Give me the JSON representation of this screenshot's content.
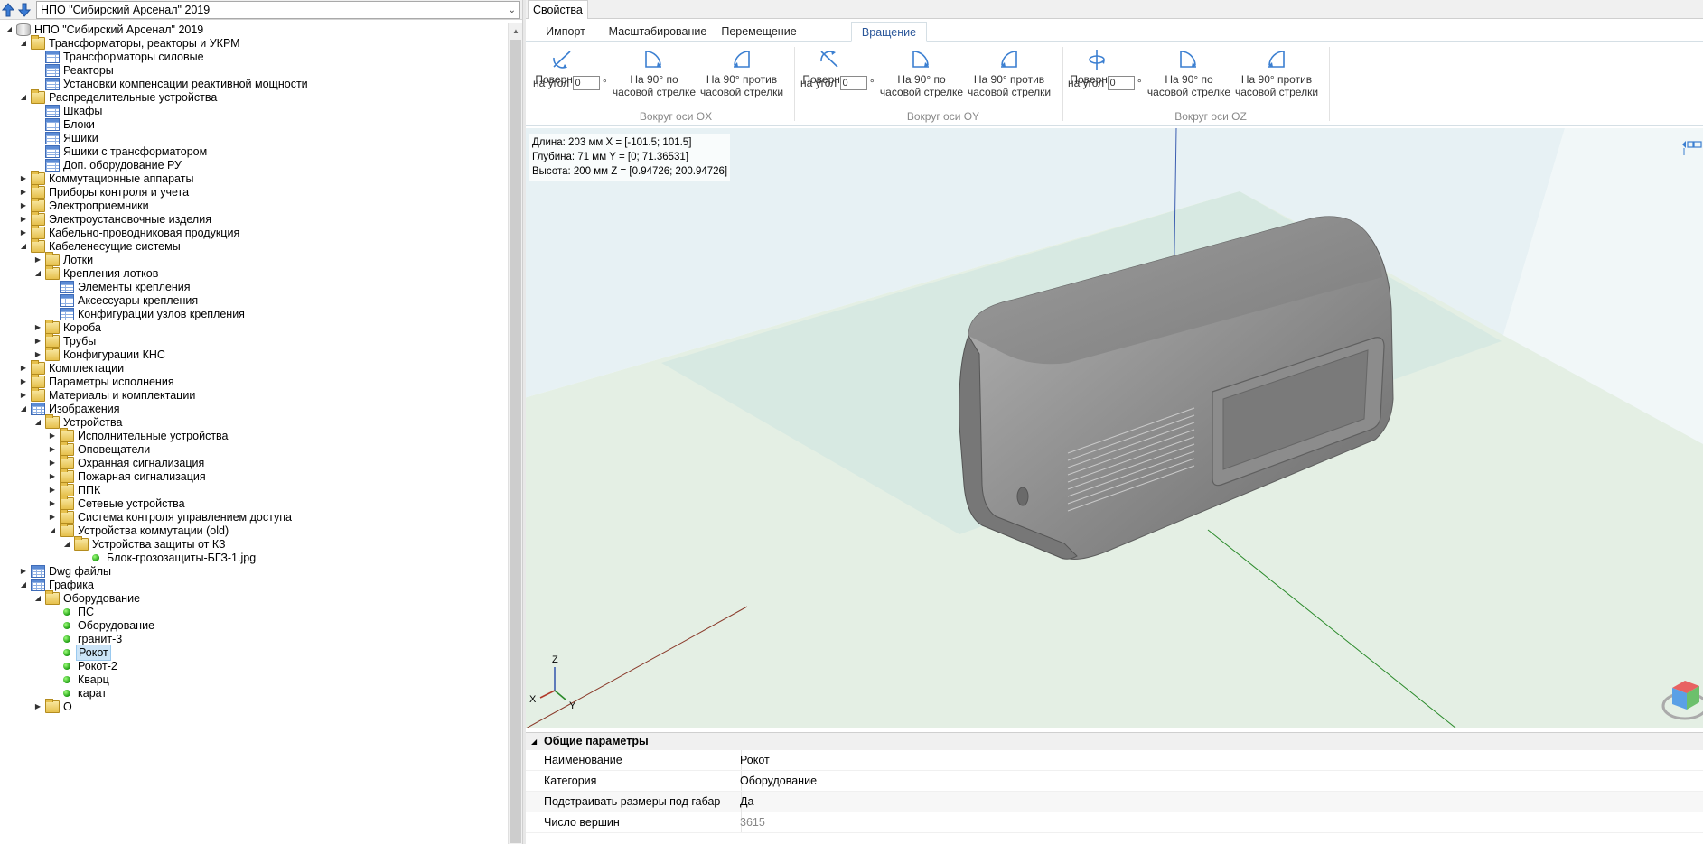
{
  "left_panel": {
    "catalog_select_value": "НПО \"Сибирский Арсенал\" 2019",
    "tree": [
      {
        "label": "НПО \"Сибирский Арсенал\" 2019",
        "icon": "database-icon",
        "level": 0,
        "expanded": true
      },
      {
        "label": "Трансформаторы, реакторы и УКРМ",
        "icon": "folder-open-icon",
        "level": 1,
        "expanded": true
      },
      {
        "label": "Трансформаторы силовые",
        "icon": "table-icon",
        "level": 2
      },
      {
        "label": "Реакторы",
        "icon": "table-icon",
        "level": 2
      },
      {
        "label": "Установки компенсации реактивной мощности",
        "icon": "table-icon",
        "level": 2
      },
      {
        "label": "Распределительные устройства",
        "icon": "folder-open-icon",
        "level": 1,
        "expanded": true
      },
      {
        "label": "Шкафы",
        "icon": "table-icon",
        "level": 2
      },
      {
        "label": "Блоки",
        "icon": "table-icon",
        "level": 2
      },
      {
        "label": "Ящики",
        "icon": "table-icon",
        "level": 2
      },
      {
        "label": "Ящики с трансформатором",
        "icon": "table-icon",
        "level": 2
      },
      {
        "label": "Доп. оборудование РУ",
        "icon": "table-icon",
        "level": 2
      },
      {
        "label": "Коммутационные аппараты",
        "icon": "folder-icon",
        "level": 1,
        "expanded": false
      },
      {
        "label": "Приборы контроля и учета",
        "icon": "folder-icon",
        "level": 1,
        "expanded": false
      },
      {
        "label": "Электроприемники",
        "icon": "folder-icon",
        "level": 1,
        "expanded": false
      },
      {
        "label": "Электроустановочные изделия",
        "icon": "folder-icon",
        "level": 1,
        "expanded": false
      },
      {
        "label": "Кабельно-проводниковая продукция",
        "icon": "folder-icon",
        "level": 1,
        "expanded": false
      },
      {
        "label": "Кабеленесущие системы",
        "icon": "folder-open-icon",
        "level": 1,
        "expanded": true
      },
      {
        "label": "Лотки",
        "icon": "folder-icon",
        "level": 2,
        "expanded": false
      },
      {
        "label": "Крепления лотков",
        "icon": "folder-open-icon",
        "level": 2,
        "expanded": true
      },
      {
        "label": "Элементы крепления",
        "icon": "table-icon",
        "level": 3
      },
      {
        "label": "Аксессуары крепления",
        "icon": "table-icon",
        "level": 3
      },
      {
        "label": "Конфигурации узлов крепления",
        "icon": "table-icon",
        "level": 3
      },
      {
        "label": "Короба",
        "icon": "folder-icon",
        "level": 2,
        "expanded": false
      },
      {
        "label": "Трубы",
        "icon": "folder-icon",
        "level": 2,
        "expanded": false
      },
      {
        "label": "Конфигурации КНС",
        "icon": "folder-icon",
        "level": 2,
        "expanded": false
      },
      {
        "label": "Комплектации",
        "icon": "folder-icon",
        "level": 1,
        "expanded": false
      },
      {
        "label": "Параметры исполнения",
        "icon": "folder-icon",
        "level": 1,
        "expanded": false
      },
      {
        "label": "Материалы и комплектации",
        "icon": "folder-icon",
        "level": 1,
        "expanded": false
      },
      {
        "label": "Изображения",
        "icon": "table-icon",
        "level": 1,
        "expanded": true
      },
      {
        "label": "Устройства",
        "icon": "folder-open-icon",
        "level": 2,
        "expanded": true
      },
      {
        "label": "Исполнительные устройства",
        "icon": "folder-icon",
        "level": 3,
        "expanded": false
      },
      {
        "label": "Оповещатели",
        "icon": "folder-icon",
        "level": 3,
        "expanded": false
      },
      {
        "label": "Охранная сигнализация",
        "icon": "folder-icon",
        "level": 3,
        "expanded": false
      },
      {
        "label": "Пожарная сигнализация",
        "icon": "folder-icon",
        "level": 3,
        "expanded": false
      },
      {
        "label": "ППК",
        "icon": "folder-icon",
        "level": 3,
        "expanded": false
      },
      {
        "label": "Сетевые устройства",
        "icon": "folder-icon",
        "level": 3,
        "expanded": false
      },
      {
        "label": "Система контроля управлением доступа",
        "icon": "folder-icon",
        "level": 3,
        "expanded": false
      },
      {
        "label": "Устройства коммутации (old)",
        "icon": "folder-open-icon",
        "level": 3,
        "expanded": true
      },
      {
        "label": "Устройства защиты от КЗ",
        "icon": "folder-open-icon",
        "level": 4,
        "expanded": true
      },
      {
        "label": "Блок-грозозащиты-БГЗ-1.jpg",
        "icon": "green-dot-icon",
        "level": 5
      },
      {
        "label": "Dwg файлы",
        "icon": "table-icon",
        "level": 1,
        "expanded": false
      },
      {
        "label": "Графика",
        "icon": "table-icon",
        "level": 1,
        "expanded": true
      },
      {
        "label": "Оборудование",
        "icon": "folder-open-icon",
        "level": 2,
        "expanded": true
      },
      {
        "label": "ПС",
        "icon": "green-dot-icon",
        "level": 3
      },
      {
        "label": "Оборудование",
        "icon": "green-dot-icon",
        "level": 3
      },
      {
        "label": "гранит-3",
        "icon": "green-dot-icon",
        "level": 3
      },
      {
        "label": "Рокот",
        "icon": "green-dot-icon",
        "level": 3,
        "selected": true
      },
      {
        "label": "Рокот-2",
        "icon": "green-dot-icon",
        "level": 3
      },
      {
        "label": "Кварц",
        "icon": "green-dot-icon",
        "level": 3
      },
      {
        "label": "карат",
        "icon": "green-dot-icon",
        "level": 3
      },
      {
        "label": "О",
        "icon": "folder-icon",
        "level": 2,
        "expanded": false
      }
    ]
  },
  "right_panel": {
    "properties_tab": "Свойства",
    "ribbon_tabs": [
      "Импорт",
      "Масштабирование",
      "Перемещение",
      "Вращение"
    ],
    "active_tab": "Вращение",
    "groups": [
      {
        "name": "Вокруг оси OX",
        "rotate_top": "Повернуть",
        "rotate_bottom": "на угол",
        "angle": "0",
        "deg": "°",
        "cw_top": "На 90° по",
        "cw_bottom": "часовой стрелке",
        "ccw_top": "На 90° против",
        "ccw_bottom": "часовой стрелки"
      },
      {
        "name": "Вокруг оси OY",
        "rotate_top": "Повернуть",
        "rotate_bottom": "на угол",
        "angle": "0",
        "deg": "°",
        "cw_top": "На 90° по",
        "cw_bottom": "часовой стрелке",
        "ccw_top": "На 90° против",
        "ccw_bottom": "часовой стрелки"
      },
      {
        "name": "Вокруг оси OZ",
        "rotate_top": "Повернуть",
        "rotate_bottom": "на угол",
        "angle": "0",
        "deg": "°",
        "cw_top": "На 90° по",
        "cw_bottom": "часовой стрелке",
        "ccw_top": "На 90° против",
        "ccw_bottom": "часовой стрелки"
      }
    ],
    "viewport": {
      "dims": [
        "Длина: 203 мм  X = [-101.5; 101.5]",
        "Глубина: 71 мм Y = [0; 71.36531]",
        "Высота: 200 мм Z = [0.94726; 200.94726]"
      ],
      "axes": {
        "x": "X",
        "y": "Y",
        "z": "Z"
      },
      "colors": {
        "grid_top": "#e4f0f3",
        "grid_floor": "#e3eee3",
        "model": "#8f8f8f",
        "axis_z": "#3c5eb0",
        "axis_x": "#8a3a2a",
        "axis_y": "#2a8a2a"
      }
    },
    "property_grid": {
      "category": "Общие параметры",
      "rows": [
        {
          "name": "Наименование",
          "value": "Рокот"
        },
        {
          "name": "Категория",
          "value": "Оборудование"
        },
        {
          "name": "Подстраивать размеры под габарит...",
          "value": "Да"
        },
        {
          "name": "Число вершин",
          "value": "3615",
          "readonly": true
        }
      ]
    }
  }
}
